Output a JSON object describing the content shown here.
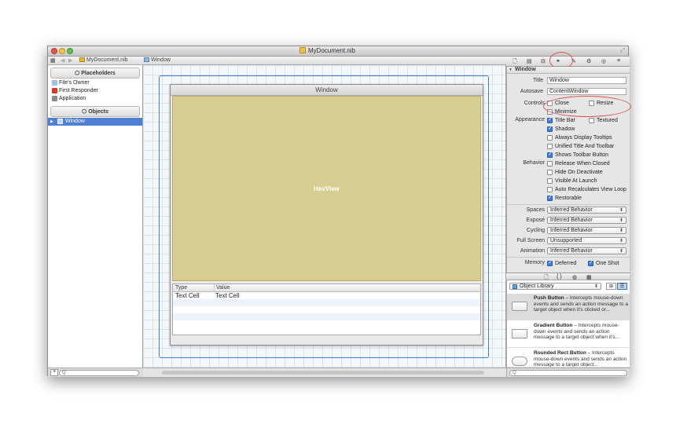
{
  "window": {
    "title": "MyDocument.nib",
    "zoom_icon": "⤢"
  },
  "jump_bar": {
    "grid_icon": "▦",
    "back": "◀",
    "forward": "▶",
    "file": "MyDocument.nib",
    "object": "Window"
  },
  "inspector_tabs": [
    "🗋",
    "▤",
    "⊟",
    "⚭",
    "✎",
    "⚙",
    "◎",
    "≡"
  ],
  "left_panel": {
    "placeholders_header": "Placeholders",
    "placeholders": [
      "File's Owner",
      "First Responder",
      "Application"
    ],
    "objects_header": "Objects",
    "objects": [
      "Window"
    ]
  },
  "canvas": {
    "window_title": "Window",
    "hexview_label": "HexView",
    "table": {
      "columns": [
        "Type",
        "Value"
      ],
      "rows": [
        [
          "Text Cell",
          "Text Cell"
        ]
      ]
    }
  },
  "inspector": {
    "section": "Window",
    "title_label": "Title",
    "title_value": "Window",
    "autosave_label": "Autosave",
    "autosave_value": "ContentWindow",
    "controls_label": "Controls",
    "close": "Close",
    "resize": "Resize",
    "minimize": "Minimize",
    "appearance_label": "Appearance",
    "title_bar": "Title Bar",
    "textured": "Textured",
    "shadow": "Shadow",
    "always_tooltips": "Always Display Tooltips",
    "unified": "Unified Title And Toolbar",
    "shows_toolbar": "Shows Toolbar Button",
    "behavior_label": "Behavior",
    "release": "Release When Closed",
    "hide_deactivate": "Hide On Deactivate",
    "visible_launch": "Visible At Launch",
    "auto_recalc": "Auto Recalculates View Loop",
    "restorable": "Restorable",
    "spaces_label": "Spaces",
    "spaces_value": "Inferred Behavior",
    "expose_label": "Exposé",
    "expose_value": "Inferred Behavior",
    "cycling_label": "Cycling",
    "cycling_value": "Inferred Behavior",
    "fullscreen_label": "Full Screen",
    "fullscreen_value": "Unsupported",
    "animation_label": "Animation",
    "animation_value": "Inferred Behavior",
    "memory_label": "Memory",
    "deferred": "Deferred",
    "one_shot": "One Shot"
  },
  "library_tabs": [
    "🗋",
    "{ }",
    "◍",
    "▦"
  ],
  "library": {
    "selector": "Object Library",
    "view_grid": "⊞",
    "view_list": "☰",
    "items": [
      {
        "name": "Push Button",
        "desc": " – Intercepts mouse-down events and sends an action message to a target object when it's clicked or..."
      },
      {
        "name": "Gradient Button",
        "desc": " – Intercepts mouse-down events and sends an action message to a target object when it's..."
      },
      {
        "name": "Rounded Rect Button",
        "desc": " – Intercepts mouse-down events and sends an action message to a target object..."
      }
    ]
  },
  "search": {
    "glyph": "Q"
  },
  "left_bottom": {
    "add": "+"
  }
}
